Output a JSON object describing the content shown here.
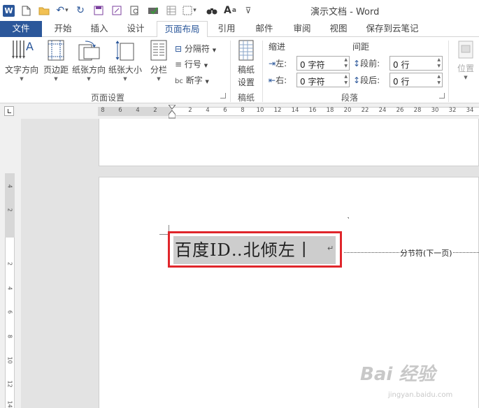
{
  "window": {
    "title": "演示文档 - Word",
    "app_badge": "W"
  },
  "qat": {
    "undo_caret": "▾",
    "more_caret": "▾",
    "font_size_sup": "a"
  },
  "tabs": [
    {
      "label": "文件"
    },
    {
      "label": "开始"
    },
    {
      "label": "插入"
    },
    {
      "label": "设计"
    },
    {
      "label": "页面布局"
    },
    {
      "label": "引用"
    },
    {
      "label": "邮件"
    },
    {
      "label": "审阅"
    },
    {
      "label": "视图"
    },
    {
      "label": "保存到云笔记"
    }
  ],
  "ribbon": {
    "page_setup": {
      "text_direction": "文字方向",
      "margins": "页边距",
      "orientation": "纸张方向",
      "size": "纸张大小",
      "columns": "分栏",
      "breaks": "分隔符",
      "line_numbers": "行号",
      "hyphenation": "断字",
      "group_label": "页面设置"
    },
    "draft": {
      "button": "稿纸设置",
      "button_line1": "稿纸",
      "button_line2": "设置",
      "group_label": "稿纸"
    },
    "paragraph": {
      "indent_header": "缩进",
      "spacing_header": "间距",
      "left_label": "左:",
      "right_label": "右:",
      "before_label": "段前:",
      "after_label": "段后:",
      "left_value": "0 字符",
      "right_value": "0 字符",
      "before_value": "0 行",
      "after_value": "0 行",
      "group_label": "段落"
    },
    "arrange": {
      "position": "位置"
    }
  },
  "ruler": {
    "top_numbers": [
      "8",
      "6",
      "4",
      "2",
      "2",
      "4",
      "6",
      "8",
      "10",
      "12",
      "14",
      "16",
      "18",
      "20",
      "22",
      "24",
      "26",
      "28",
      "30",
      "32",
      "34"
    ],
    "left_numbers": [
      "4",
      "2",
      "2",
      "4",
      "6",
      "8",
      "10",
      "12",
      "14"
    ]
  },
  "document": {
    "selected_text": "百度ID‥北倾左丨",
    "paragraph_mark": "↵",
    "section_break": "分节符(下一页)"
  },
  "watermark": {
    "main": "Bai 经验",
    "sub": "jingyan.baidu.com"
  },
  "colors": {
    "brand": "#2b579a",
    "highlight_box": "#e0262b",
    "selection_bg": "#cdcdcd"
  }
}
